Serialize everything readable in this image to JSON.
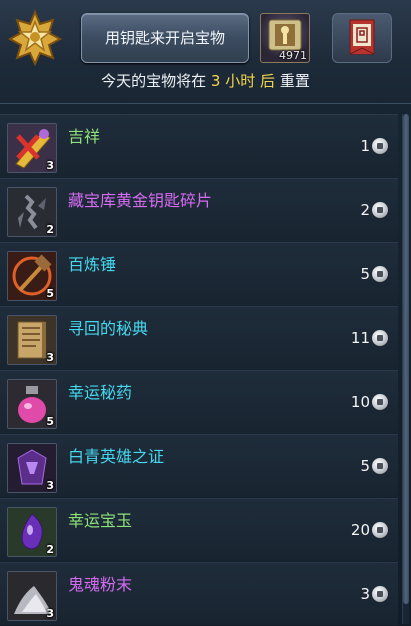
{
  "header": {
    "open_button_label": "用钥匙来开启宝物",
    "key_count": "4971",
    "reset": {
      "prefix": "今天的宝物将在",
      "hours": "3",
      "unit": "小时",
      "after": "后",
      "suffix": "重置"
    }
  },
  "colors": {
    "green_name": "#8fe07a",
    "purple_name": "#d56cf2",
    "cyan_name": "#46d8ee",
    "highlight": "#f2d64a"
  },
  "items": [
    {
      "name": "吉祥",
      "qty": "3",
      "price": "1",
      "color": "#8fe07a",
      "icon": "lucky-charm-icon"
    },
    {
      "name": "藏宝库黄金钥匙碎片",
      "qty": "2",
      "price": "2",
      "color": "#d56cf2",
      "icon": "key-fragment-icon"
    },
    {
      "name": "百炼锤",
      "qty": "5",
      "price": "5",
      "color": "#46d8ee",
      "icon": "hammer-icon"
    },
    {
      "name": "寻回的秘典",
      "qty": "3",
      "price": "11",
      "color": "#46d8ee",
      "icon": "scroll-icon"
    },
    {
      "name": "幸运秘药",
      "qty": "5",
      "price": "10",
      "color": "#46d8ee",
      "icon": "potion-icon"
    },
    {
      "name": "白青英雄之证",
      "qty": "3",
      "price": "5",
      "color": "#46d8ee",
      "icon": "hero-token-icon"
    },
    {
      "name": "幸运宝玉",
      "qty": "2",
      "price": "20",
      "color": "#8fe07a",
      "icon": "gem-icon"
    },
    {
      "name": "鬼魂粉末",
      "qty": "3",
      "price": "3",
      "color": "#d56cf2",
      "icon": "powder-icon"
    }
  ]
}
